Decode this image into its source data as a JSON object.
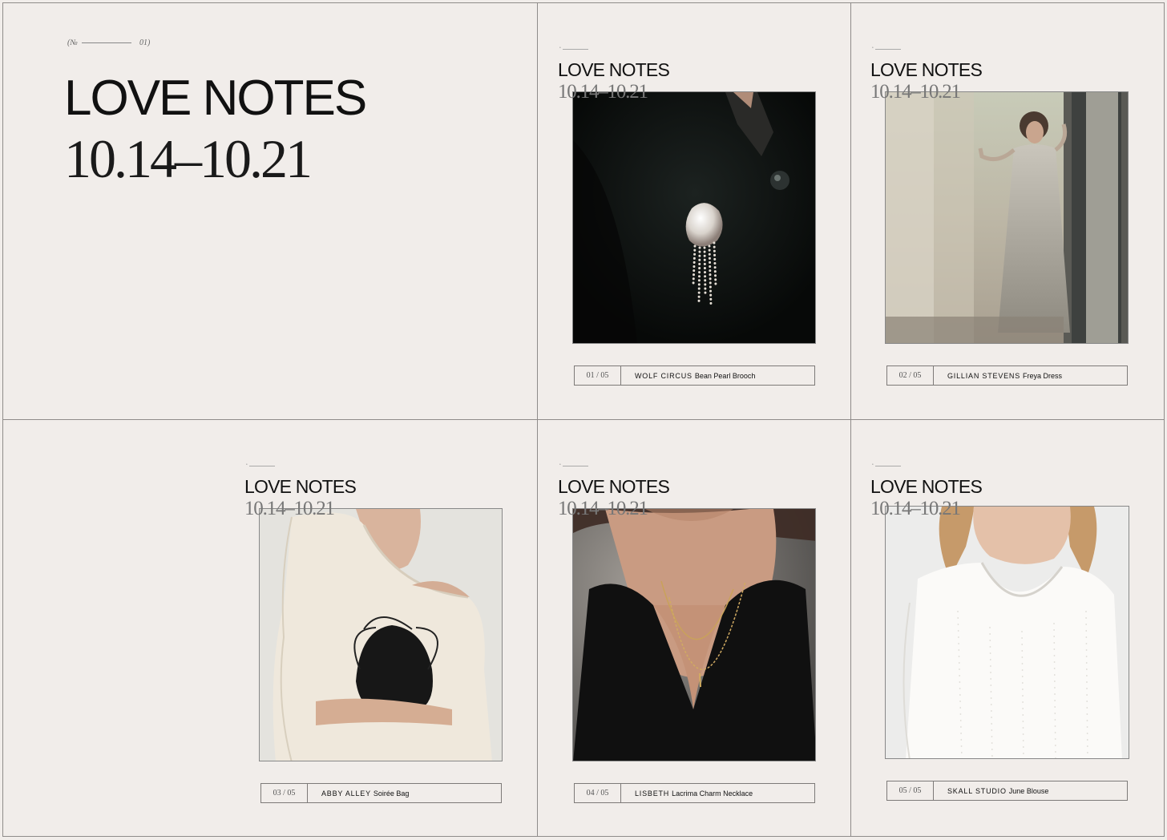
{
  "intro": {
    "no_prefix": "(№",
    "no_number": "01)",
    "title": "LOVE NOTES",
    "date_range": "10.14–10.21"
  },
  "cards": [
    {
      "title": "LOVE NOTES",
      "date_range": "10.14–10.21",
      "index": "01 / 05",
      "brand": "WOLF CIRCUS",
      "product": "Bean Pearl Brooch",
      "photo_subject": "black jacket with pearl brooch"
    },
    {
      "title": "LOVE NOTES",
      "date_range": "10.14–10.21",
      "index": "02 / 05",
      "brand": "GILLIAN STEVENS",
      "product": "Freya Dress",
      "photo_subject": "woman in white dress at doorway"
    },
    {
      "title": "LOVE NOTES",
      "date_range": "10.14–10.21",
      "index": "03 / 05",
      "brand": "ABBY ALLEY",
      "product": "Soirée Bag",
      "photo_subject": "cream sweater with black drawstring bag"
    },
    {
      "title": "LOVE NOTES",
      "date_range": "10.14–10.21",
      "index": "04 / 05",
      "brand": "LISBETH",
      "product": "Lacrima Charm Necklace",
      "photo_subject": "gold layered necklace on black shirt"
    },
    {
      "title": "LOVE NOTES",
      "date_range": "10.14–10.21",
      "index": "05 / 05",
      "brand": "SKALL STUDIO",
      "product": "June Blouse",
      "photo_subject": "white pointelle long sleeve blouse"
    }
  ],
  "colors": {
    "background": "#f1edea",
    "border": "#8f8c8a",
    "text": "#111111"
  }
}
